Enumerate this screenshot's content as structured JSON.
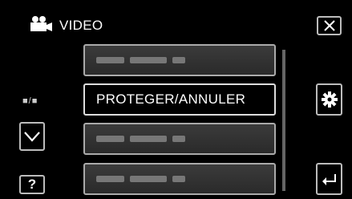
{
  "header": {
    "title": "VIDEO",
    "mode_icon": "video-camera-icon"
  },
  "menu": {
    "items": [
      {
        "label": "",
        "state": "blurred"
      },
      {
        "label": "PROTEGER/ANNULER",
        "state": "selected"
      },
      {
        "label": "",
        "state": "blurred"
      },
      {
        "label": "",
        "state": "blurred"
      }
    ]
  },
  "sidebar": {
    "page_indicator": "■/■"
  },
  "buttons": {
    "close": "close-icon",
    "settings": "gear-icon",
    "down": "chevron-down-icon",
    "help": "?",
    "back": "return-icon"
  }
}
